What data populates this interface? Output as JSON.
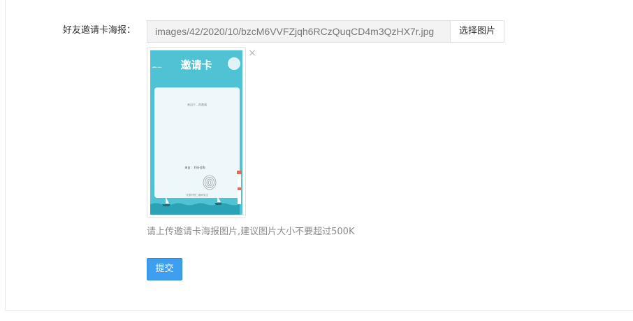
{
  "form": {
    "poster_label": "好友邀请卡海报：",
    "file_path_value": "images/42/2020/10/bzcM6VVFZjqh6RCzQuqCD4m3QzHX7r.jpg",
    "choose_image_label": "选择图片",
    "remove_glyph": "×",
    "help_text": "请上传邀请卡海报图片,建议图片大小不要超过500K",
    "submit_label": "提交"
  },
  "poster_preview": {
    "title": "邀请卡",
    "line_top": "来自于…的邀请",
    "line_mid": "来自：  利分佳购",
    "line_bottom": "长按识别二维码关注"
  },
  "colors": {
    "primary_button": "#3e9ff0",
    "poster_sky": "#4fc3d3",
    "poster_sea": "#2aa3b6"
  }
}
